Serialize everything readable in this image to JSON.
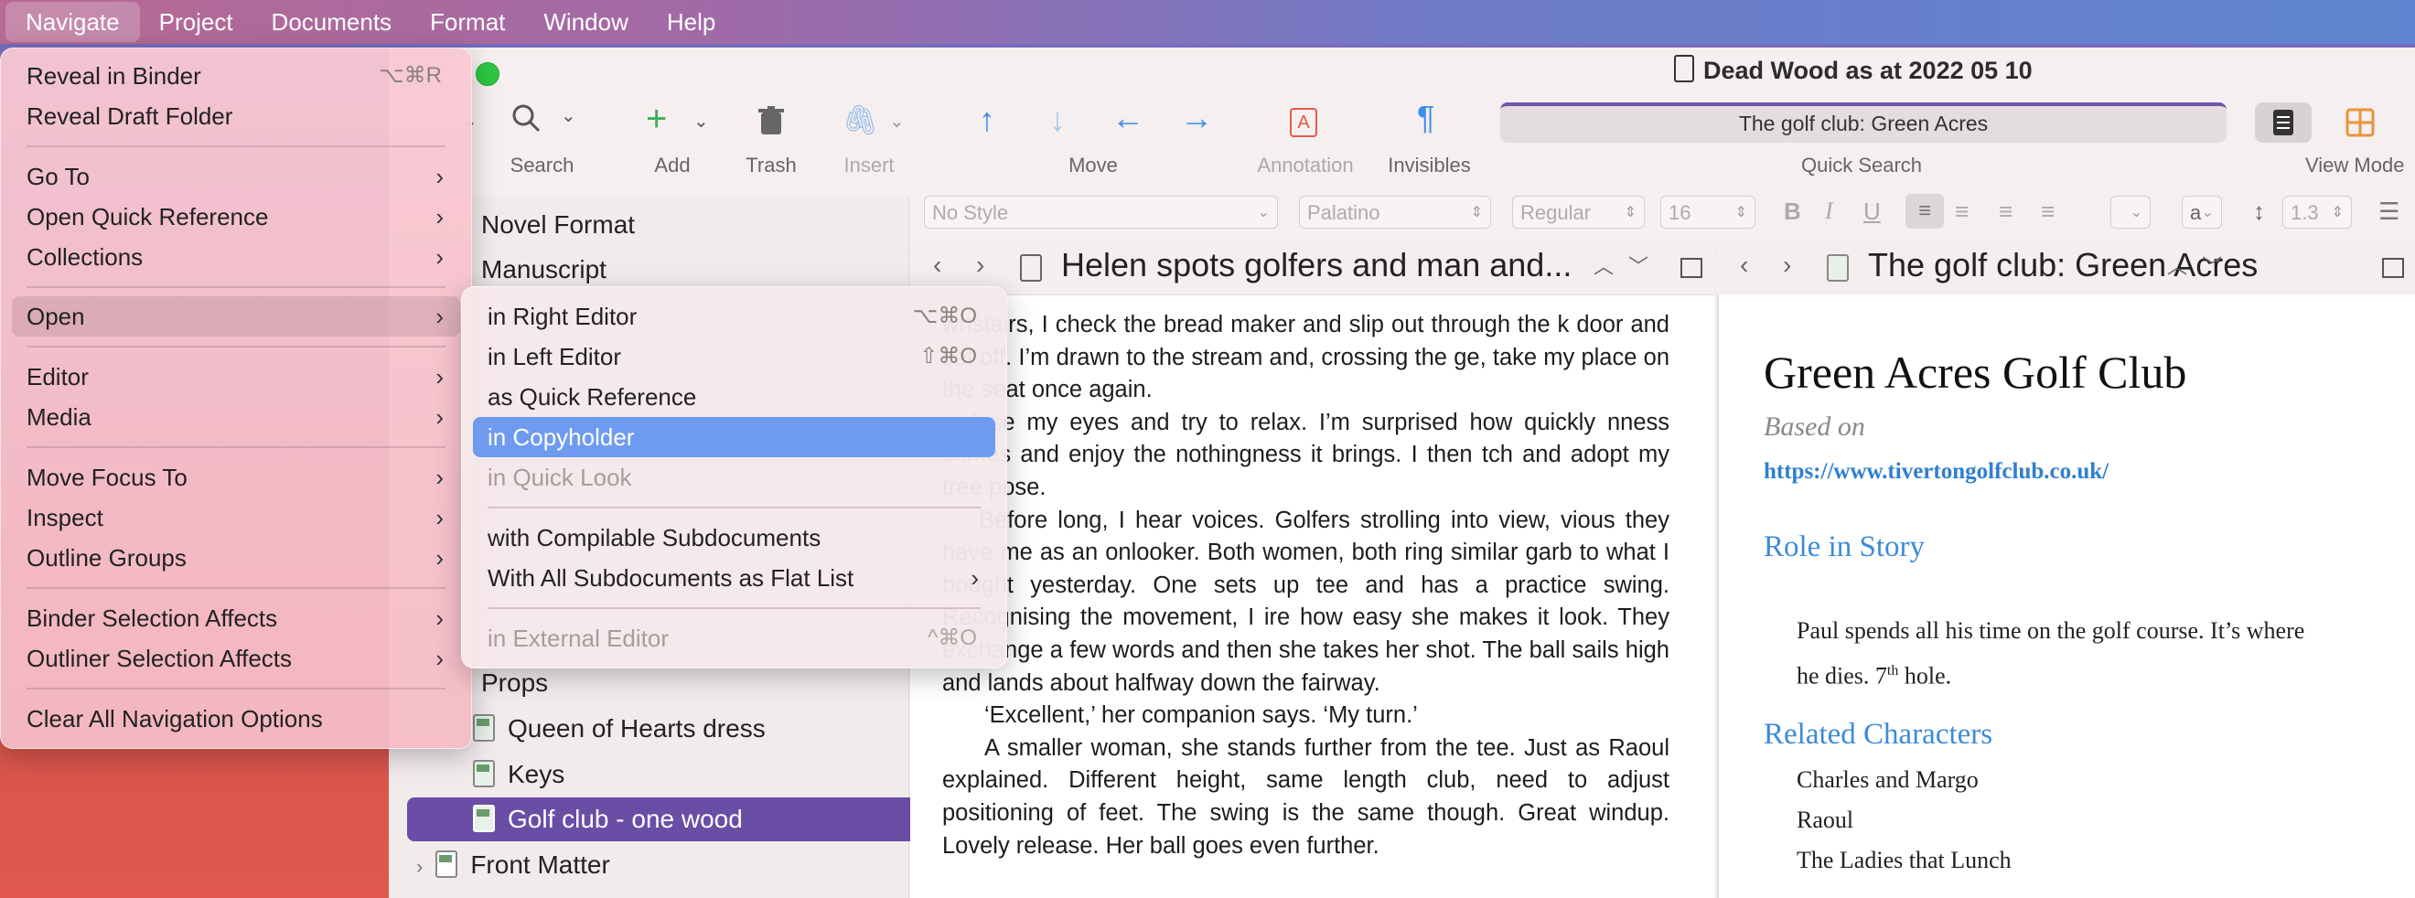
{
  "menubar": {
    "items": [
      "Navigate",
      "Project",
      "Documents",
      "Format",
      "Window",
      "Help"
    ]
  },
  "window": {
    "title": "Dead Wood as at 2022 05 10"
  },
  "toolbar": {
    "search_label": "Search",
    "add_label": "Add",
    "trash_label": "Trash",
    "insert_label": "Insert",
    "move_label": "Move",
    "annotation_label": "Annotation",
    "invisibles_label": "Invisibles",
    "quick_search_value": "The golf club: Green Acres",
    "quick_search_label": "Quick Search",
    "view_mode_label": "View Mode"
  },
  "formatbar": {
    "style": "No Style",
    "font": "Palatino",
    "weight": "Regular",
    "size": "16",
    "line_spacing": "1.3",
    "char_button": "a"
  },
  "binder": {
    "top_items": [
      "Novel Format",
      "Manuscript"
    ],
    "props_label": "Props",
    "items": [
      "Queen of Hearts dress",
      "Keys",
      "Golf club - one wood"
    ],
    "front_matter": "Front Matter"
  },
  "editor_left": {
    "title": "Helen spots golfers and man and...",
    "paragraphs": [
      "wnstairs, I check the bread maker and slip out through the k door and set off. I’m drawn to the stream and, crossing the ge, take my place on the seat once again.",
      "close my eyes and try to relax. I’m surprised how quickly nness comes and enjoy the nothingness it brings. I then tch and adopt my tree pose.",
      "Before long, I hear voices. Golfers strolling into view, vious they have me as an onlooker. Both women, both ring similar garb to what I bought yesterday. One sets up tee and has a practice swing. Recognising the movement, I ire how easy she makes it look. They exchange a few words and then she takes her shot. The ball sails high and lands about halfway down the fairway.",
      "‘Excellent,’ her companion says. ‘My turn.’",
      "A smaller woman, she stands further from the tee. Just as Raoul explained. Different height, same length club, need to adjust positioning of feet. The swing is the same though. Great windup. Lovely release. Her ball goes even further."
    ]
  },
  "editor_right": {
    "title": "The golf club: Green Acres",
    "heading": "Green Acres Golf Club",
    "based_on": "Based on",
    "link": "https://www.tivertongolfclub.co.uk/",
    "role_heading": "Role in Story",
    "role_text_1": "Paul spends all his time on the golf course. It’s where",
    "role_text_2": "he dies. 7",
    "role_sup": "th",
    "role_text_3": " hole.",
    "related_heading": "Related Characters",
    "characters": [
      "Charles and Margo",
      "Raoul",
      "The Ladies that Lunch"
    ]
  },
  "navigate_menu": {
    "reveal_binder": "Reveal in Binder",
    "reveal_binder_sc": "⌥⌘R",
    "reveal_draft": "Reveal Draft Folder",
    "go_to": "Go To",
    "open_quick_ref": "Open Quick Reference",
    "collections": "Collections",
    "open": "Open",
    "editor": "Editor",
    "media": "Media",
    "move_focus": "Move Focus To",
    "inspect": "Inspect",
    "outline_groups": "Outline Groups",
    "binder_sel": "Binder Selection Affects",
    "outliner_sel": "Outliner Selection Affects",
    "clear_all": "Clear All Navigation Options"
  },
  "open_submenu": {
    "right_editor": "in Right Editor",
    "right_editor_sc": "⌥⌘O",
    "left_editor": "in Left Editor",
    "left_editor_sc": "⇧⌘O",
    "quick_ref": "as Quick Reference",
    "copyholder": "in Copyholder",
    "quick_look": "in Quick Look",
    "compilable": "with Compilable Subdocuments",
    "flat_list": "With All Subdocuments as Flat List",
    "external": "in External Editor",
    "external_sc": "^⌘O"
  },
  "colors": {
    "accent": "#6a4ea6",
    "menu_selection": "#6e9bf0",
    "link": "#2f7fd3",
    "heading_blue": "#3b8bd8"
  }
}
